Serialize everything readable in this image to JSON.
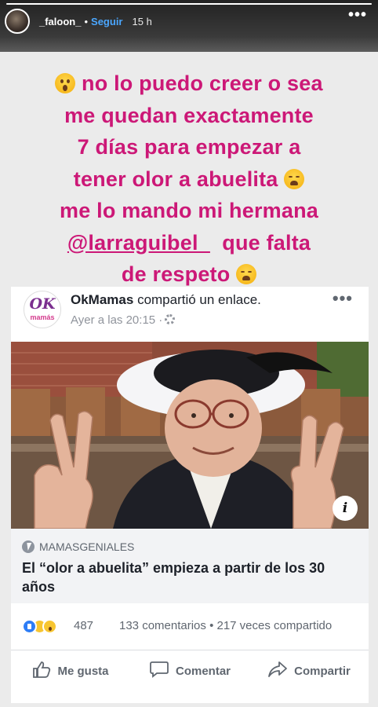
{
  "header": {
    "progress": 1.0,
    "username": "_faloon_",
    "separator": "•",
    "follow_label": "Seguir",
    "time_ago": "15 h",
    "more_glyph": "•••"
  },
  "story": {
    "line1": "no lo puedo creer o sea",
    "line2": "me quedan exactamente",
    "line3": "7 días para empezar a",
    "line4": "tener olor a abuelita",
    "line5": "me lo mando mi hermana",
    "mention": "@larraguibel_",
    "line6_rest": "que falta",
    "line7": "de respeto",
    "emoji_start": "face-screaming-in-fear",
    "emoji_tired": "weary-face",
    "text_color": "#cc1877"
  },
  "post": {
    "logo_ok": "OK",
    "logo_mamas": "mamás",
    "author": "OkMamas",
    "action_text": "compartió un enlace.",
    "timestamp": "Ayer a las 20:15 ·",
    "more_glyph": "•••",
    "info_badge": "i",
    "link_source": "MAMASGENIALES",
    "link_title": "El “olor a abuelita” empieza a partir de los 30 años",
    "reaction_count": "487",
    "share_stats": "133 comentarios • 217 veces compartido",
    "like_label": "Me gusta",
    "comment_label": "Comentar",
    "share_label": "Compartir"
  }
}
